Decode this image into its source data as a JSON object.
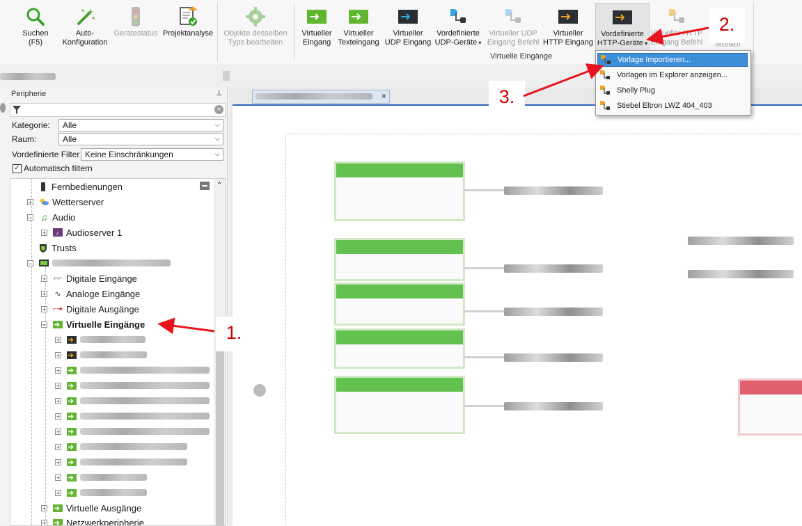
{
  "ribbon": {
    "buttons": [
      {
        "id": "search",
        "label": "Suchen\n(F5)",
        "icon": "search-icon",
        "disabled": false
      },
      {
        "id": "autoconfig",
        "label": "Auto-\nKonfiguration",
        "icon": "magic-wand-icon",
        "disabled": false
      },
      {
        "id": "status",
        "label": "Gerätestatus",
        "icon": "traffic-light-icon",
        "disabled": true
      },
      {
        "id": "analysis",
        "label": "Projektanalyse",
        "icon": "document-check-icon",
        "disabled": false
      },
      {
        "id": "same_type",
        "label": "Objekte desselben\nTyps bearbeiten",
        "icon": "gear-icon",
        "disabled": true
      },
      {
        "id": "vin",
        "label": "Virtueller\nEingang",
        "icon": "green-input-icon",
        "disabled": false
      },
      {
        "id": "vtext",
        "label": "Virtueller\nTexteingang",
        "icon": "green-input-icon",
        "disabled": false
      },
      {
        "id": "vudp",
        "label": "Virtueller\nUDP Eingang",
        "icon": "udp-input-icon",
        "disabled": false
      },
      {
        "id": "udp_devices",
        "label": "Vordefinierte\nUDP-Geräte",
        "icon": "udp-device-icon",
        "disabled": false
      },
      {
        "id": "udp_cmd",
        "label": "Virtueller UDP\nEingang Befehl",
        "icon": "udp-command-icon",
        "disabled": true
      },
      {
        "id": "vhttp",
        "label": "Virtueller\nHTTP Eingang",
        "icon": "http-input-icon",
        "disabled": false
      },
      {
        "id": "http_devices",
        "label": "Vordefinierte\nHTTP-Geräte",
        "icon": "http-device-icon",
        "disabled": false
      },
      {
        "id": "http_cmd",
        "label": "Virtueller HTTP\nEingang Befehl",
        "icon": "http-command-icon",
        "disabled": true
      },
      {
        "id": "monitor",
        "label": "Monitor",
        "icon": "monitor-icon",
        "disabled": true
      }
    ],
    "group_label": "Virtuelle Eingänge"
  },
  "dropdown": {
    "items": [
      {
        "label": "Vorlage Importieren...",
        "selected": true
      },
      {
        "label": "Vorlagen im Explorer anzeigen...",
        "selected": false
      },
      {
        "label": "Shelly Plug",
        "selected": false
      },
      {
        "label": "Stiebel Eltron LWZ 404_403",
        "selected": false
      }
    ]
  },
  "panel": {
    "title": "Peripherie",
    "pin": "ᵖ",
    "kategorie_label": "Kategorie:",
    "kategorie_value": "Alle",
    "raum_label": "Raum:",
    "raum_value": "Alle",
    "filter_label": "Vordefinierte Filter",
    "filter_value": "Keine Einschränkungen",
    "auto_filter_label": "Automatisch filtern",
    "auto_filter_checked": true
  },
  "tree": {
    "items": [
      {
        "label": "Fernbedienungen",
        "icon": "remote-icon"
      },
      {
        "label": "Wetterserver",
        "icon": "weather-icon"
      },
      {
        "label": "Audio",
        "icon": "music-icon"
      },
      {
        "label": "Audioserver 1",
        "icon": "audioserver-icon"
      },
      {
        "label": "Trusts",
        "icon": "shield-icon"
      },
      {
        "label": "Digitale Eingänge",
        "icon": "digital-input-icon"
      },
      {
        "label": "Analoge Eingänge",
        "icon": "analog-input-icon"
      },
      {
        "label": "Digitale Ausgänge",
        "icon": "digital-output-icon"
      },
      {
        "label": "Virtuelle Eingänge",
        "icon": "virtual-input-icon"
      },
      {
        "label": "Virtuelle Ausgänge",
        "icon": "virtual-output-icon"
      },
      {
        "label": "Netzwerkperipherie",
        "icon": "network-icon"
      }
    ]
  },
  "callouts": {
    "one": "1.",
    "two": "2.",
    "three": "3."
  },
  "colors": {
    "accent": "#2f63b8",
    "annotation": "#e8141b",
    "block_green": "#63c24f",
    "menu_selected": "#3d8fd8"
  }
}
